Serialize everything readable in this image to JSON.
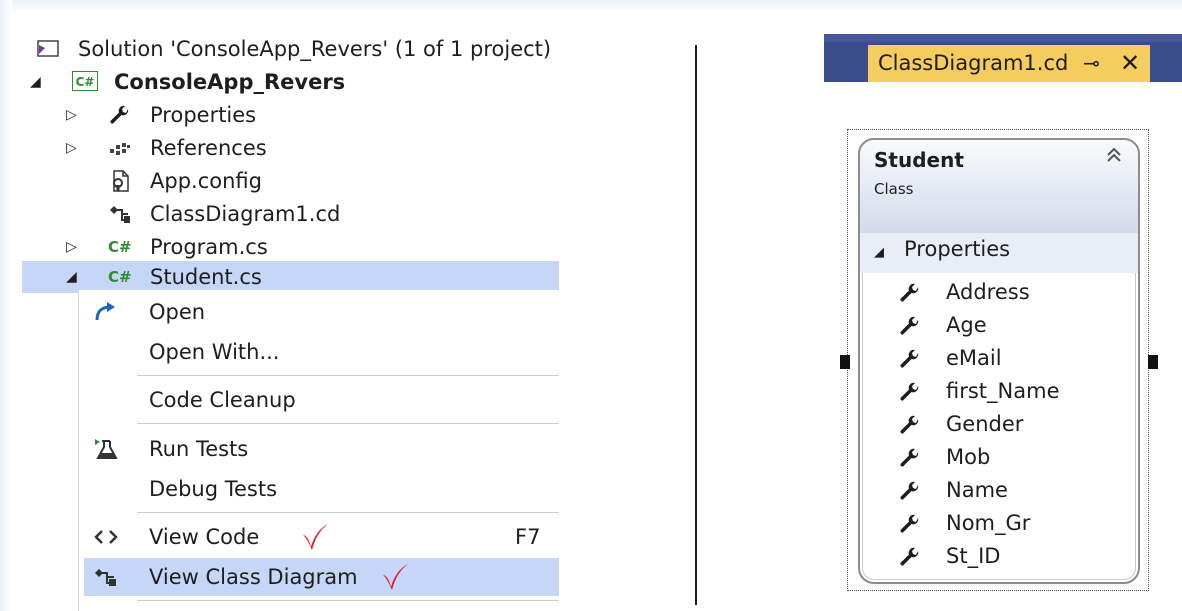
{
  "solution_explorer": {
    "solution_label": "Solution 'ConsoleApp_Revers' (1 of 1 project)",
    "project": {
      "badge": "C#",
      "label": "ConsoleApp_Revers"
    },
    "items": [
      {
        "label": "Properties",
        "icon": "wrench-icon",
        "expandable": true
      },
      {
        "label": "References",
        "icon": "references-icon",
        "expandable": true
      },
      {
        "label": "App.config",
        "icon": "config-file-icon",
        "expandable": false
      },
      {
        "label": "ClassDiagram1.cd",
        "icon": "class-diagram-icon",
        "expandable": false
      },
      {
        "label": "Program.cs",
        "icon": "csharp-file-icon",
        "badge": "C#",
        "expandable": true
      },
      {
        "label": "Student.cs",
        "icon": "csharp-file-icon",
        "badge": "C#",
        "expandable": true,
        "selected": true
      }
    ]
  },
  "context_menu": {
    "items": [
      {
        "label": "Open",
        "icon": "open-arrow-icon"
      },
      {
        "label": "Open With..."
      },
      {
        "label": "Code Cleanup"
      },
      {
        "label": "Run Tests",
        "icon": "run-tests-icon"
      },
      {
        "label": "Debug Tests"
      },
      {
        "label": "View Code",
        "icon": "code-brackets-icon",
        "shortcut": "F7"
      },
      {
        "label": "View Class Diagram",
        "icon": "class-diagram-icon"
      }
    ]
  },
  "document_tab": {
    "label": "ClassDiagram1.cd",
    "pin_glyph": "⊸",
    "close_glyph": "✕"
  },
  "class_diagram": {
    "class_name": "Student",
    "class_kind": "Class",
    "section_label": "Properties",
    "properties": [
      "Address",
      "Age",
      "eMail",
      "first_Name",
      "Gender",
      "Mob",
      "Name",
      "Nom_Gr",
      "St_ID"
    ]
  },
  "colors": {
    "selection": "#c6d6f7",
    "tab_active": "#f5cc5e",
    "tabbar": "#3a4c8a",
    "checkmark": "#e0141e",
    "csharp_green": "#2e8b2e"
  }
}
